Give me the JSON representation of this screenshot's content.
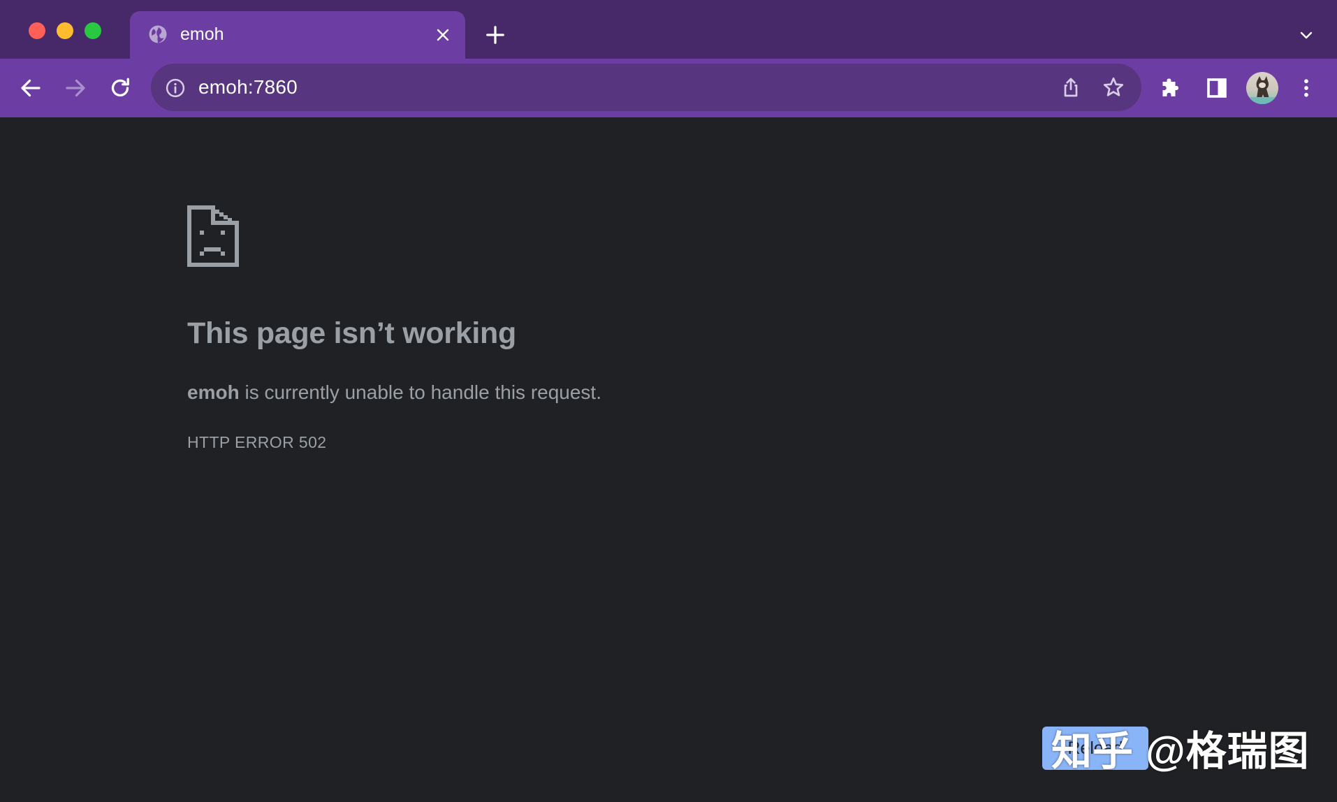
{
  "tab": {
    "title": "emoh"
  },
  "omnibox": {
    "url": "emoh:7860"
  },
  "error": {
    "title": "This page isn’t working",
    "host": "emoh",
    "message": " is currently unable to handle this request.",
    "code": "HTTP ERROR 502",
    "reload_label": "Reload"
  },
  "watermark": {
    "text": "知乎 @格瑞图"
  },
  "icons": {
    "tab": "globe-icon",
    "back": "back-arrow-icon",
    "forward": "forward-arrow-icon",
    "reload": "reload-icon",
    "site_info": "info-icon",
    "share": "share-icon",
    "bookmark": "star-icon",
    "extensions": "puzzle-icon",
    "side_panel": "side-panel-icon",
    "menu": "kebab-menu-icon",
    "error": "sad-document-icon"
  },
  "colors": {
    "tab_strip": "#472868",
    "toolbar": "#6c3da3",
    "omnibox": "#58357f",
    "page_background": "#202124",
    "error_text": "#9aa0a6",
    "reload_button": "#8ab4f8"
  }
}
